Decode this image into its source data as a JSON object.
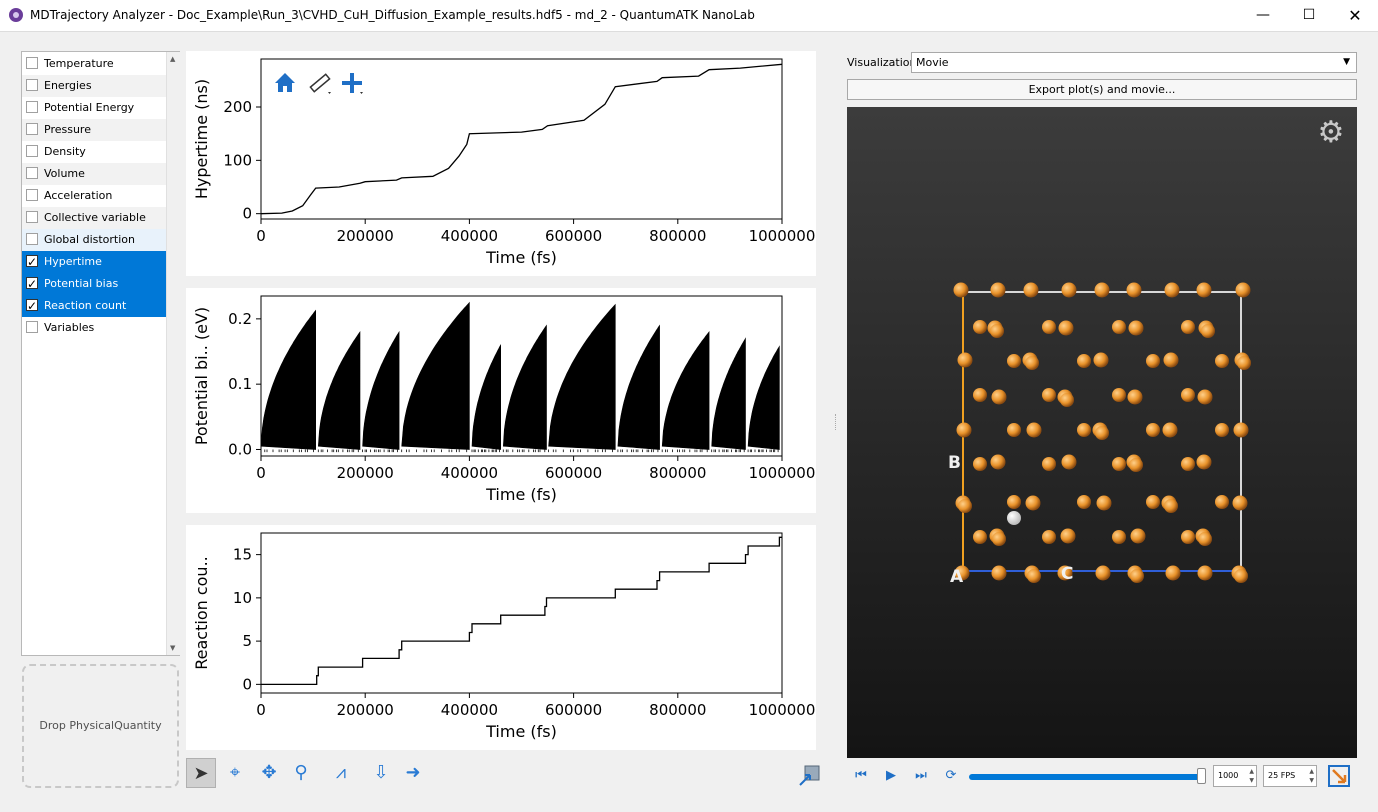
{
  "window": {
    "title": "MDTrajectory Analyzer - Doc_Example\\Run_3\\CVHD_CuH_Diffusion_Example_results.hdf5 - md_2 - QuantumATK NanoLab",
    "minimize_glyph": "—",
    "maximize_glyph": "☐",
    "close_glyph": "✕"
  },
  "properties": [
    {
      "label": "Temperature",
      "checked": false
    },
    {
      "label": "Energies",
      "checked": false
    },
    {
      "label": "Potential Energy",
      "checked": false
    },
    {
      "label": "Pressure",
      "checked": false
    },
    {
      "label": "Density",
      "checked": false
    },
    {
      "label": "Volume",
      "checked": false
    },
    {
      "label": "Acceleration",
      "checked": false
    },
    {
      "label": "Collective variable",
      "checked": false
    },
    {
      "label": "Global distortion",
      "checked": false
    },
    {
      "label": "Hypertime",
      "checked": true
    },
    {
      "label": "Potential bias",
      "checked": true
    },
    {
      "label": "Reaction count",
      "checked": true
    },
    {
      "label": "Variables",
      "checked": false
    }
  ],
  "drop_zone": {
    "label": "Drop PhysicalQuantity"
  },
  "chart_data": [
    {
      "type": "line",
      "ylabel": "Hypertime (ns)",
      "xlabel": "Time (fs)",
      "xlim": [
        0,
        1000000
      ],
      "ylim": [
        -10,
        290
      ],
      "xticks": [
        "0",
        "200000",
        "400000",
        "600000",
        "800000",
        "1000000"
      ],
      "yticks": [
        "0",
        "100",
        "200"
      ],
      "x": [
        0,
        40000,
        60000,
        80000,
        95000,
        105000,
        150000,
        190000,
        200000,
        260000,
        270000,
        330000,
        360000,
        380000,
        395000,
        400000,
        500000,
        540000,
        550000,
        620000,
        660000,
        680000,
        760000,
        770000,
        840000,
        860000,
        920000,
        1000000
      ],
      "y": [
        0,
        1,
        5,
        15,
        35,
        48,
        50,
        57,
        60,
        63,
        67,
        70,
        85,
        108,
        130,
        150,
        153,
        158,
        165,
        175,
        205,
        238,
        248,
        255,
        258,
        270,
        273,
        280
      ]
    },
    {
      "type": "line",
      "ylabel": "Potential bi.. (eV)",
      "xlabel": "Time (fs)",
      "xlim": [
        0,
        1000000
      ],
      "ylim": [
        -0.01,
        0.235
      ],
      "xticks": [
        "0",
        "200000",
        "400000",
        "600000",
        "800000",
        "1000000"
      ],
      "yticks": [
        "0.0",
        "0.1",
        "0.2"
      ],
      "sawtooth_cycles": [
        {
          "start": 0,
          "end": 105000,
          "peak": 0.213
        },
        {
          "start": 110000,
          "end": 190000,
          "peak": 0.18
        },
        {
          "start": 195000,
          "end": 265000,
          "peak": 0.18
        },
        {
          "start": 270000,
          "end": 400000,
          "peak": 0.225
        },
        {
          "start": 405000,
          "end": 460000,
          "peak": 0.16
        },
        {
          "start": 465000,
          "end": 548000,
          "peak": 0.19
        },
        {
          "start": 552000,
          "end": 680000,
          "peak": 0.222
        },
        {
          "start": 685000,
          "end": 765000,
          "peak": 0.19
        },
        {
          "start": 770000,
          "end": 860000,
          "peak": 0.18
        },
        {
          "start": 865000,
          "end": 930000,
          "peak": 0.17
        },
        {
          "start": 935000,
          "end": 995000,
          "peak": 0.158
        }
      ]
    },
    {
      "type": "line",
      "ylabel": "Reaction cou..",
      "xlabel": "Time (fs)",
      "xlim": [
        0,
        1000000
      ],
      "ylim": [
        -1,
        17.5
      ],
      "xticks": [
        "0",
        "200000",
        "400000",
        "600000",
        "800000",
        "1000000"
      ],
      "yticks": [
        "0",
        "5",
        "10",
        "15"
      ],
      "step_x": [
        0,
        107000,
        110000,
        195000,
        265000,
        270000,
        400000,
        405000,
        460000,
        545000,
        548000,
        680000,
        760000,
        765000,
        860000,
        930000,
        935000,
        995000,
        1000000
      ],
      "step_y": [
        0,
        1,
        2,
        3,
        4,
        5,
        6,
        7,
        8,
        9,
        10,
        11,
        12,
        13,
        14,
        15,
        16,
        17,
        17
      ]
    }
  ],
  "plot_toolbar": {
    "home_icon": "home-icon",
    "ruler_icon": "ruler-icon",
    "add_icon": "plus-icon"
  },
  "bottom_toolbar": [
    {
      "name": "pointer-tool-icon",
      "glyph": "➤"
    },
    {
      "name": "crosshair-tool-icon",
      "glyph": "⌖"
    },
    {
      "name": "pan-tool-icon",
      "glyph": "✥"
    },
    {
      "name": "zoom-tool-icon",
      "glyph": "⚲"
    },
    {
      "name": "peak-tool-icon",
      "glyph": "⩘"
    },
    {
      "name": "export-data-icon",
      "glyph": "⇩"
    },
    {
      "name": "forward-arrow-icon",
      "glyph": "➜"
    }
  ],
  "visualization": {
    "label": "Visualization",
    "selected": "Movie",
    "export_label": "Export plot(s) and movie..."
  },
  "viewer": {
    "axis_labels": {
      "a": "A",
      "b": "B",
      "c": "C"
    },
    "atom_color": "#e8922a",
    "h_atom_color": "#ffffff",
    "axis_a_color": "#f0a020",
    "axis_c_color": "#2f5fd8",
    "cell_color": "#d8d8d8"
  },
  "movie": {
    "first_glyph": "⏮",
    "play_glyph": "▶",
    "last_glyph": "⏭",
    "loop_glyph": "⟳",
    "frame_value": "1000",
    "fps_value": "25 FPS",
    "slider_fraction": 1.0
  }
}
